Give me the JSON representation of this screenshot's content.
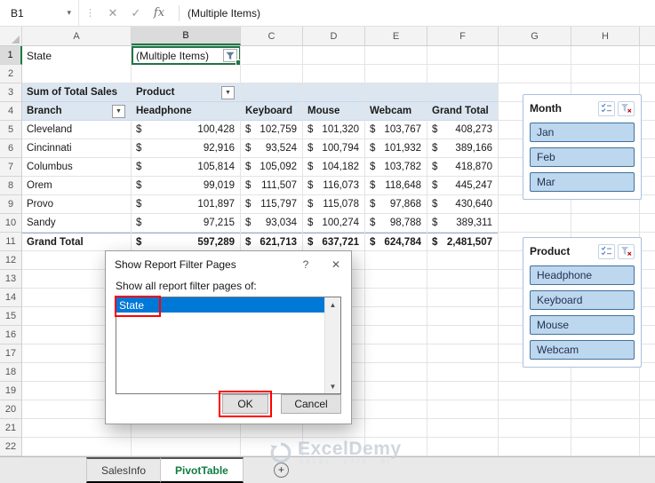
{
  "formula_bar": {
    "name_box": "B1",
    "formula": "(Multiple Items)"
  },
  "icons": {
    "dropdown": "▾",
    "dots": "⋮",
    "cancel": "✕",
    "check": "✓",
    "fx": "fx",
    "field_dropdown": "▼",
    "help": "?",
    "close": "✕",
    "scroll_up": "▲",
    "scroll_down": "▼"
  },
  "grid": {
    "columns": [
      "A",
      "B",
      "C",
      "D",
      "E",
      "F",
      "G",
      "H"
    ],
    "row_numbers": [
      "1",
      "2",
      "3",
      "4",
      "5",
      "6",
      "7",
      "8",
      "9",
      "10",
      "11",
      "12",
      "13",
      "14",
      "15",
      "16",
      "17",
      "18",
      "19",
      "20",
      "21",
      "22"
    ],
    "selected_col": "B",
    "selected_row": "1"
  },
  "pivot": {
    "filter_label": "State",
    "filter_value": "(Multiple Items)",
    "values_label": "Sum of Total Sales",
    "col_field": "Product",
    "row_field": "Branch",
    "currency": "$",
    "columns": [
      "Headphone",
      "Keyboard",
      "Mouse",
      "Webcam",
      "Grand Total"
    ],
    "rows": [
      {
        "label": "Cleveland",
        "values": [
          "100,428",
          "102,759",
          "101,320",
          "103,767",
          "408,273"
        ]
      },
      {
        "label": "Cincinnati",
        "values": [
          "92,916",
          "93,524",
          "100,794",
          "101,932",
          "389,166"
        ]
      },
      {
        "label": "Columbus",
        "values": [
          "105,814",
          "105,092",
          "104,182",
          "103,782",
          "418,870"
        ]
      },
      {
        "label": "Orem",
        "values": [
          "99,019",
          "111,507",
          "116,073",
          "118,648",
          "445,247"
        ]
      },
      {
        "label": "Provo",
        "values": [
          "101,897",
          "115,797",
          "115,078",
          "97,868",
          "430,640"
        ]
      },
      {
        "label": "Sandy",
        "values": [
          "97,215",
          "93,034",
          "100,274",
          "98,788",
          "389,311"
        ]
      }
    ],
    "total": {
      "label": "Grand Total",
      "values": [
        "597,289",
        "621,713",
        "637,721",
        "624,784",
        "2,481,507"
      ]
    }
  },
  "slicers": [
    {
      "title": "Month",
      "items": [
        "Jan",
        "Feb",
        "Mar"
      ]
    },
    {
      "title": "Product",
      "items": [
        "Headphone",
        "Keyboard",
        "Mouse",
        "Webcam"
      ]
    }
  ],
  "dialog": {
    "title": "Show Report Filter Pages",
    "prompt": "Show all report filter pages of:",
    "items": [
      "State"
    ],
    "ok": "OK",
    "cancel": "Cancel"
  },
  "tabs": {
    "sheets": [
      "SalesInfo",
      "PivotTable"
    ],
    "active": "PivotTable",
    "add": "+"
  },
  "watermark": {
    "name": "ExcelDemy",
    "tagline": "EXCEL · DATA · BI"
  },
  "colors": {
    "excel_green": "#107C41",
    "selection_green": "#217346",
    "pivot_header": "#DCE6F1",
    "slicer_fill": "#BDD7EE",
    "slicer_border": "#41719C",
    "list_selection": "#0078D7",
    "annotation_red": "#FF0000"
  }
}
